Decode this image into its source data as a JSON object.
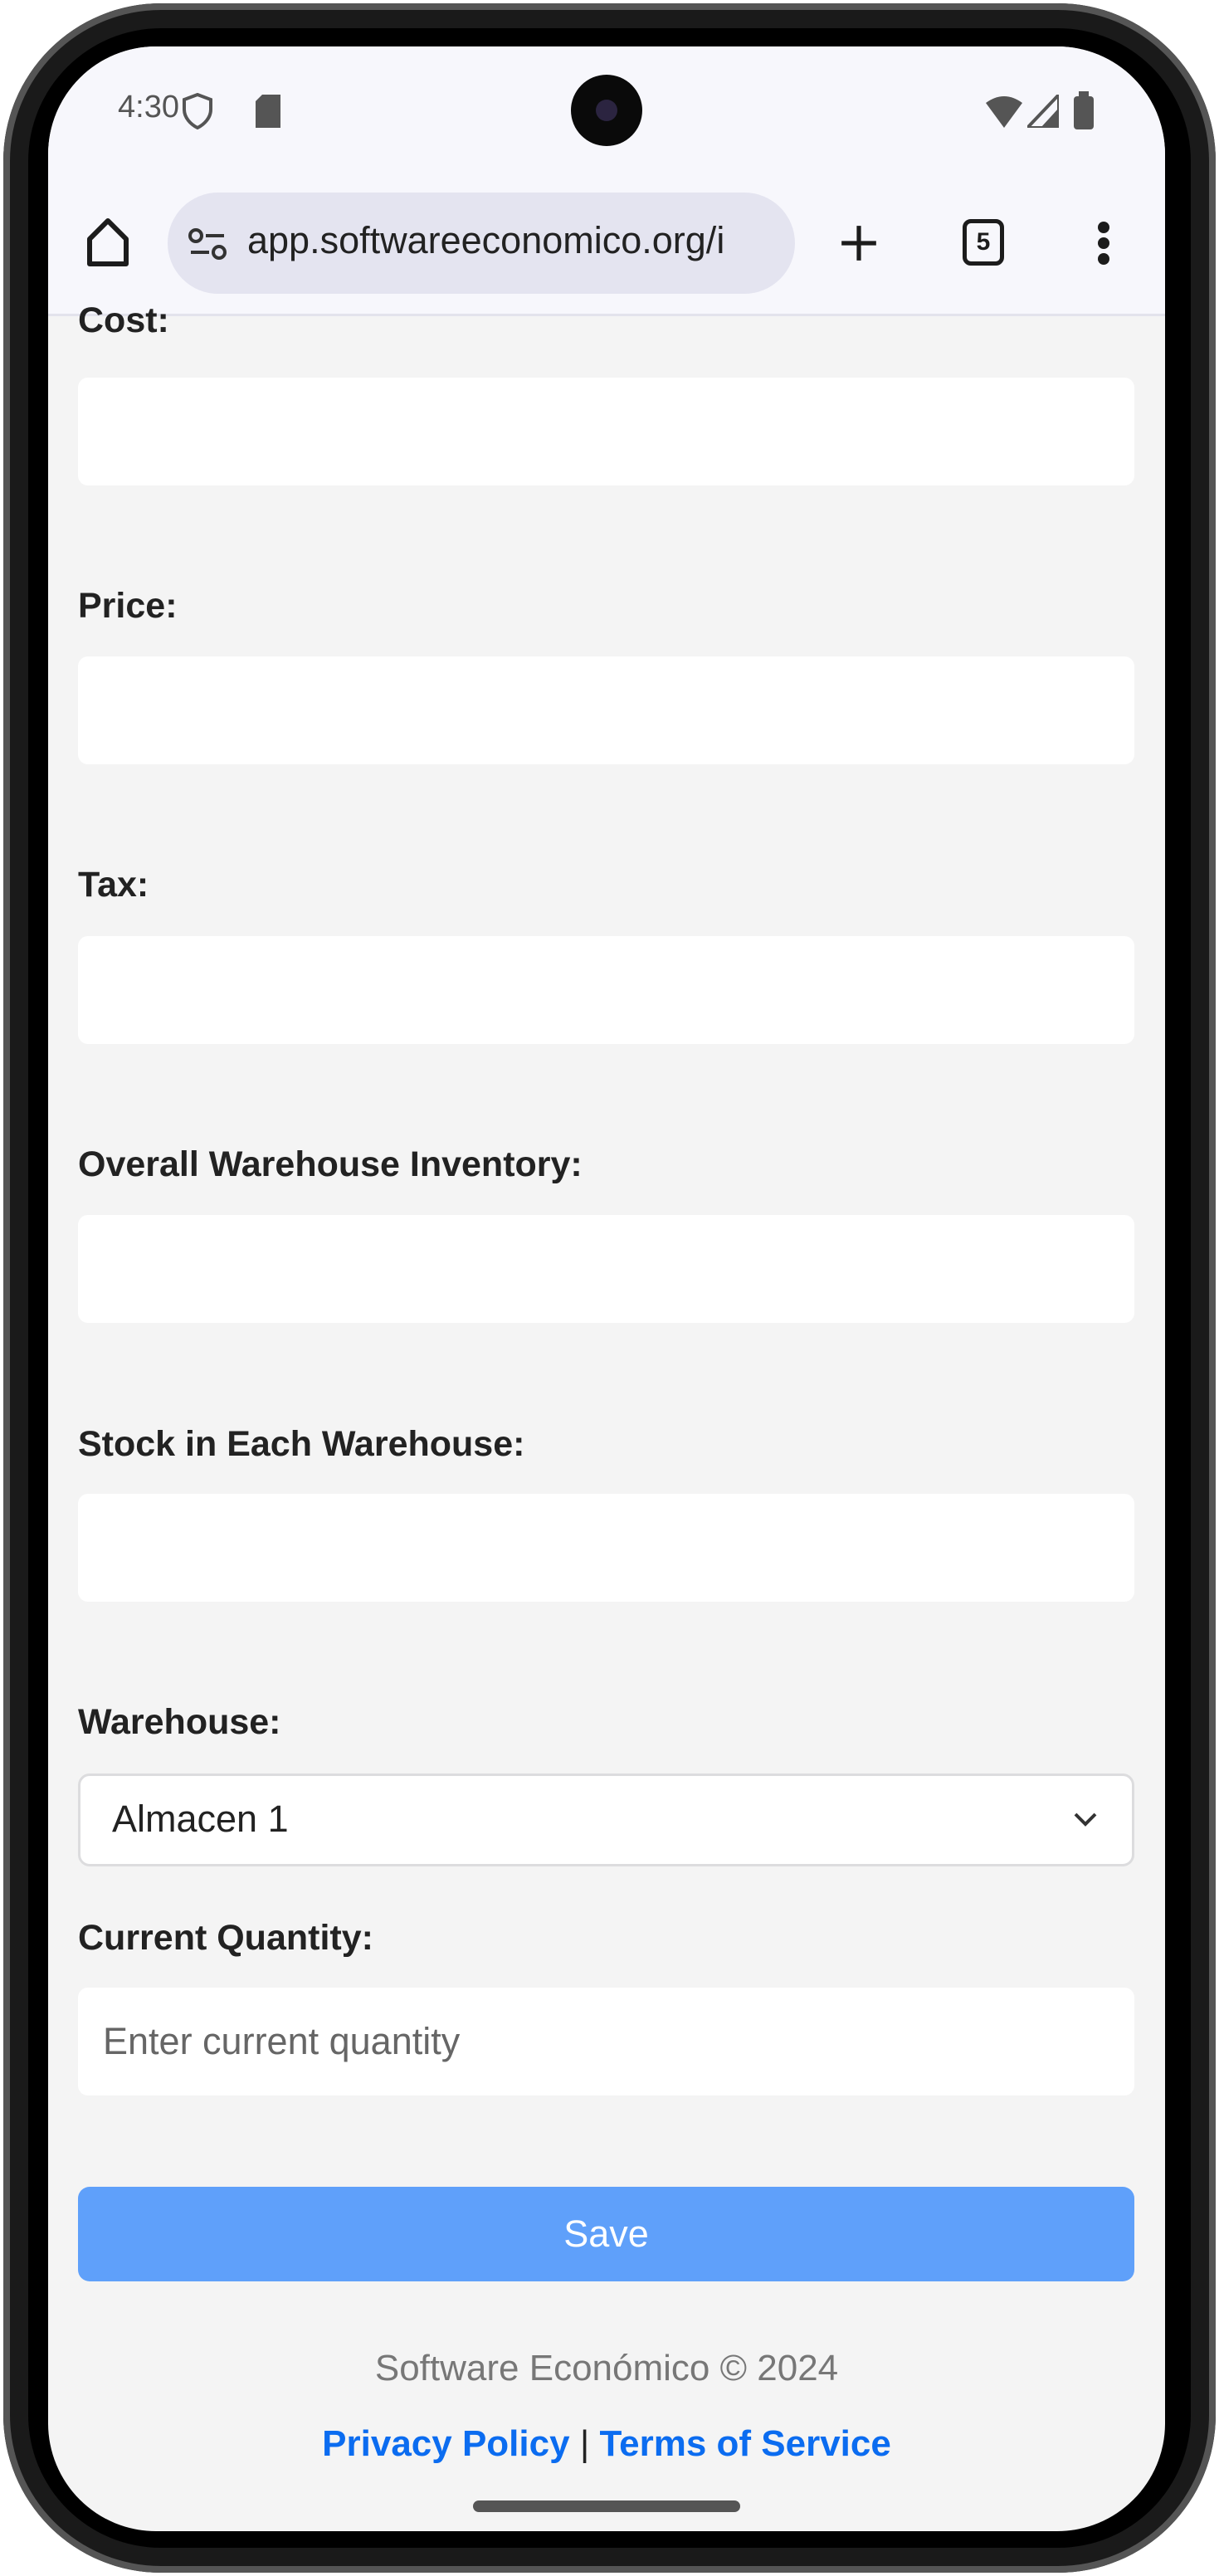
{
  "status_bar": {
    "time": "4:30",
    "icons": [
      "shield-icon",
      "sd-card-icon",
      "wifi-icon",
      "signal-icon",
      "battery-icon"
    ]
  },
  "browser": {
    "url": "app.softwareeconomico.org/i",
    "tab_count": "5",
    "icons": [
      "home-icon",
      "site-settings-icon",
      "plus-icon",
      "tabs-icon",
      "more-vert-icon"
    ]
  },
  "form": {
    "cost_label": "Cost:",
    "price_label": "Price:",
    "tax_label": "Tax:",
    "overall_label": "Overall Warehouse Inventory:",
    "stock_label": "Stock in Each Warehouse:",
    "warehouse_label": "Warehouse:",
    "warehouse_value": "Almacen 1",
    "quantity_label": "Current Quantity:",
    "quantity_placeholder": "Enter current quantity",
    "save_label": "Save"
  },
  "footer": {
    "copyright": "Software Económico © 2024",
    "privacy": "Privacy Policy",
    "separator": "|",
    "terms": "Terms of Service"
  },
  "colors": {
    "accent": "#5fa0fa",
    "link": "#0b6cf0",
    "background": "#f4f4f4"
  }
}
